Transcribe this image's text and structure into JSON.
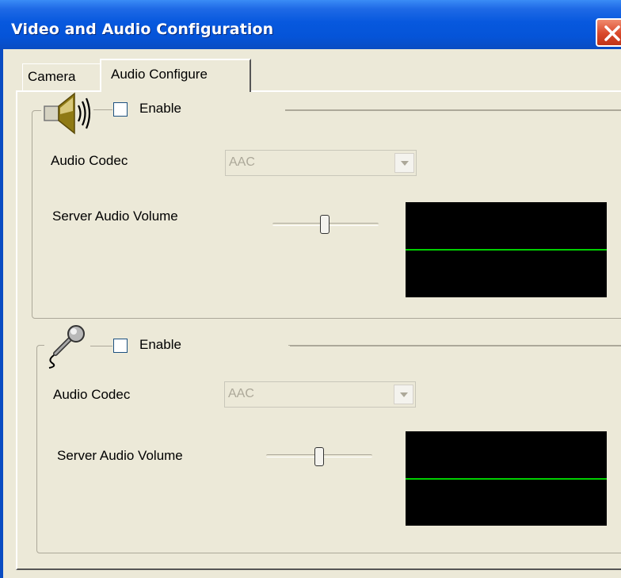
{
  "window": {
    "title": "Video and Audio Configuration",
    "close_icon": "close-icon"
  },
  "tabs": [
    {
      "label": "Camera",
      "selected": false
    },
    {
      "label": "Audio Configure",
      "selected": true
    }
  ],
  "speaker_group": {
    "icon": "speaker-icon",
    "enable_label": "Enable",
    "enabled": false,
    "codec_label": "Audio Codec",
    "codec_value": "AAC",
    "volume_label": "Server Audio Volume",
    "volume_level": 0.5
  },
  "microphone_group": {
    "icon": "microphone-icon",
    "enable_label": "Enable",
    "enabled": false,
    "codec_label": "Audio Codec",
    "codec_value": "AAC",
    "volume_label": "Server Audio Volume",
    "volume_level": 0.5
  },
  "colors": {
    "titlebar": "#0554d8",
    "meter_background": "#000000",
    "meter_trace": "#00d000"
  }
}
